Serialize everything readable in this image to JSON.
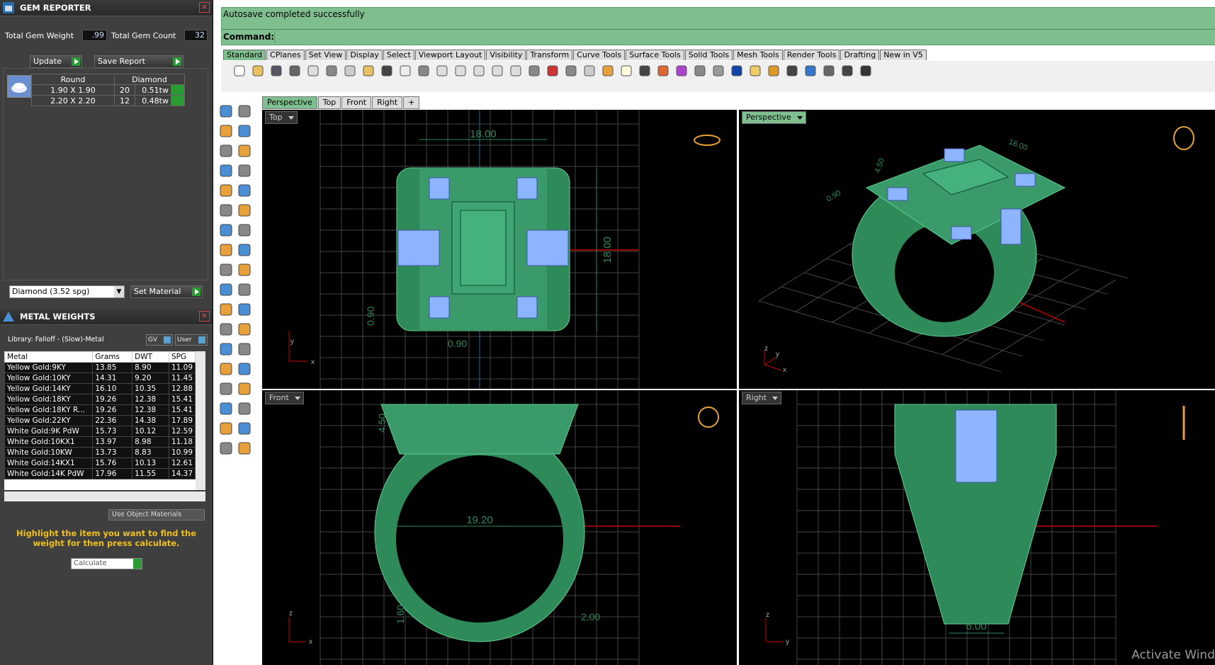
{
  "gem_reporter": {
    "title": "GEM REPORTER",
    "total_weight_label": "Total Gem Weight",
    "total_weight_value": ".99",
    "total_count_label": "Total Gem Count",
    "total_count_value": "32",
    "update_label": "Update",
    "save_label": "Save Report",
    "table_headers": [
      "Round",
      "Diamond"
    ],
    "rows": [
      {
        "size": "1.90 X 1.90",
        "count": "20",
        "weight": "0.51tw"
      },
      {
        "size": "2.20 X 2.20",
        "count": "12",
        "weight": "0.48tw"
      }
    ],
    "material_select": "Diamond     (3.52 spg)",
    "set_material_label": "Set Material"
  },
  "metal_weights": {
    "title": "METAL WEIGHTS",
    "library": "Library: Falloff - (Slow)-Metal",
    "gv_label": "GV",
    "user_label": "User",
    "headers": [
      "Metal",
      "Grams",
      "DWT",
      "SPG"
    ],
    "rows": [
      [
        "Yellow Gold:9KY",
        "13.85",
        "8.90",
        "11.09"
      ],
      [
        "Yellow Gold:10KY",
        "14.31",
        "9.20",
        "11.45"
      ],
      [
        "Yellow Gold:14KY",
        "16.10",
        "10.35",
        "12.88"
      ],
      [
        "Yellow Gold:18KY",
        "19.26",
        "12.38",
        "15.41"
      ],
      [
        "Yellow Gold:18KY R...",
        "19.26",
        "12.38",
        "15.41"
      ],
      [
        "Yellow Gold:22KY",
        "22.36",
        "14.38",
        "17.89"
      ],
      [
        "White Gold:9K PdW",
        "15.73",
        "10.12",
        "12.59"
      ],
      [
        "White Gold:10KX1",
        "13.97",
        "8.98",
        "11.18"
      ],
      [
        "White Gold:10KW",
        "13.73",
        "8.83",
        "10.99"
      ],
      [
        "White Gold:14KX1",
        "15.76",
        "10.13",
        "12.61"
      ],
      [
        "White Gold:14K PdW",
        "17.96",
        "11.55",
        "14.37"
      ]
    ],
    "use_object_materials": "Use Object Materials",
    "instruction": "Highlight the item you want to find the weight for then press calculate.",
    "calculate_label": "Calculate"
  },
  "command": {
    "status": "Autosave completed successfully",
    "prompt": "Command:"
  },
  "toolbar_tabs": [
    "Standard",
    "CPlanes",
    "Set View",
    "Display",
    "Select",
    "Viewport Layout",
    "Visibility",
    "Transform",
    "Curve Tools",
    "Surface Tools",
    "Solid Tools",
    "Mesh Tools",
    "Render Tools",
    "Drafting",
    "New in V5"
  ],
  "viewport_tabs": [
    "Perspective",
    "Top",
    "Front",
    "Right",
    "+"
  ],
  "viewports": {
    "top": {
      "label": "Top",
      "dims": [
        "18.00",
        "18.00",
        "0.90",
        "0.90"
      ]
    },
    "perspective": {
      "label": "Perspective",
      "dims": [
        "18.00",
        "4.50",
        "0.90"
      ]
    },
    "front": {
      "label": "Front",
      "dims": [
        "4.50",
        "19.20",
        "1.60",
        "2.00"
      ]
    },
    "right": {
      "label": "Right",
      "dims": [
        "6.00"
      ]
    }
  },
  "watermark": "Activate Wind",
  "colors": {
    "accent": "#7fbf8f",
    "model": "#2f8a5a",
    "gem": "#8db4ff"
  }
}
